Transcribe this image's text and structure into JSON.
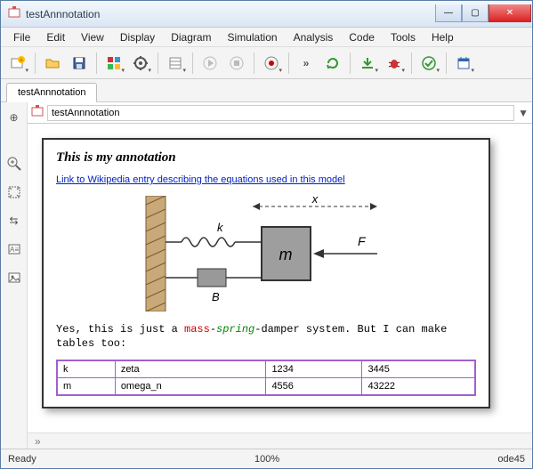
{
  "window": {
    "title": "testAnnnotation"
  },
  "menu": {
    "items": [
      "File",
      "Edit",
      "View",
      "Display",
      "Diagram",
      "Simulation",
      "Analysis",
      "Code",
      "Tools",
      "Help"
    ]
  },
  "toolbar_icons": [
    "new",
    "open",
    "save",
    "model-explorer",
    "settings",
    "library",
    "play",
    "stop",
    "record",
    "fastforward",
    "refresh",
    "download",
    "debug",
    "check",
    "calendar"
  ],
  "tabs": {
    "active": "testAnnnotation"
  },
  "breadcrumb": {
    "crumb": "testAnnnotation"
  },
  "annotation": {
    "heading": "This is my annotation",
    "link_text": "Link to Wikipedia  entry describing the equations used in this model",
    "diagram_labels": {
      "x": "x",
      "k": "k",
      "m": "m",
      "F": "F",
      "B": "B"
    },
    "body_prefix": "Yes, this is just a ",
    "body_mass": "mass",
    "body_dash1": "-",
    "body_spring": "spring",
    "body_dash2": "-",
    "body_damper": "damper system. But I can make tables too:",
    "table": {
      "rows": [
        [
          "k",
          "zeta",
          "1234",
          "3445"
        ],
        [
          "m",
          "omega_n",
          "4556",
          "43222"
        ]
      ]
    }
  },
  "status": {
    "left": "Ready",
    "zoom": "100%",
    "solver": "ode45"
  },
  "collapse": "»"
}
